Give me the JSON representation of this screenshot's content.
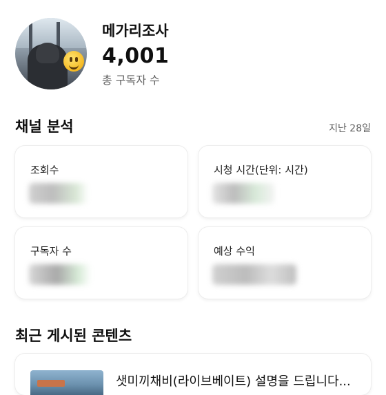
{
  "channel": {
    "name": "메가리조사",
    "subscriber_count": "4,001",
    "subscriber_label": "총 구독자 수"
  },
  "analytics": {
    "title": "채널 분석",
    "period": "지난 28일",
    "cards": [
      {
        "label": "조회수"
      },
      {
        "label": "시청 시간(단위: 시간)"
      },
      {
        "label": "구독자 수"
      },
      {
        "label": "예상 수익"
      }
    ]
  },
  "recent": {
    "title": "최근 게시된 콘텐츠",
    "items": [
      {
        "title": "샛미끼채비(라이브베이트) 설명을 드립니다..."
      }
    ]
  }
}
